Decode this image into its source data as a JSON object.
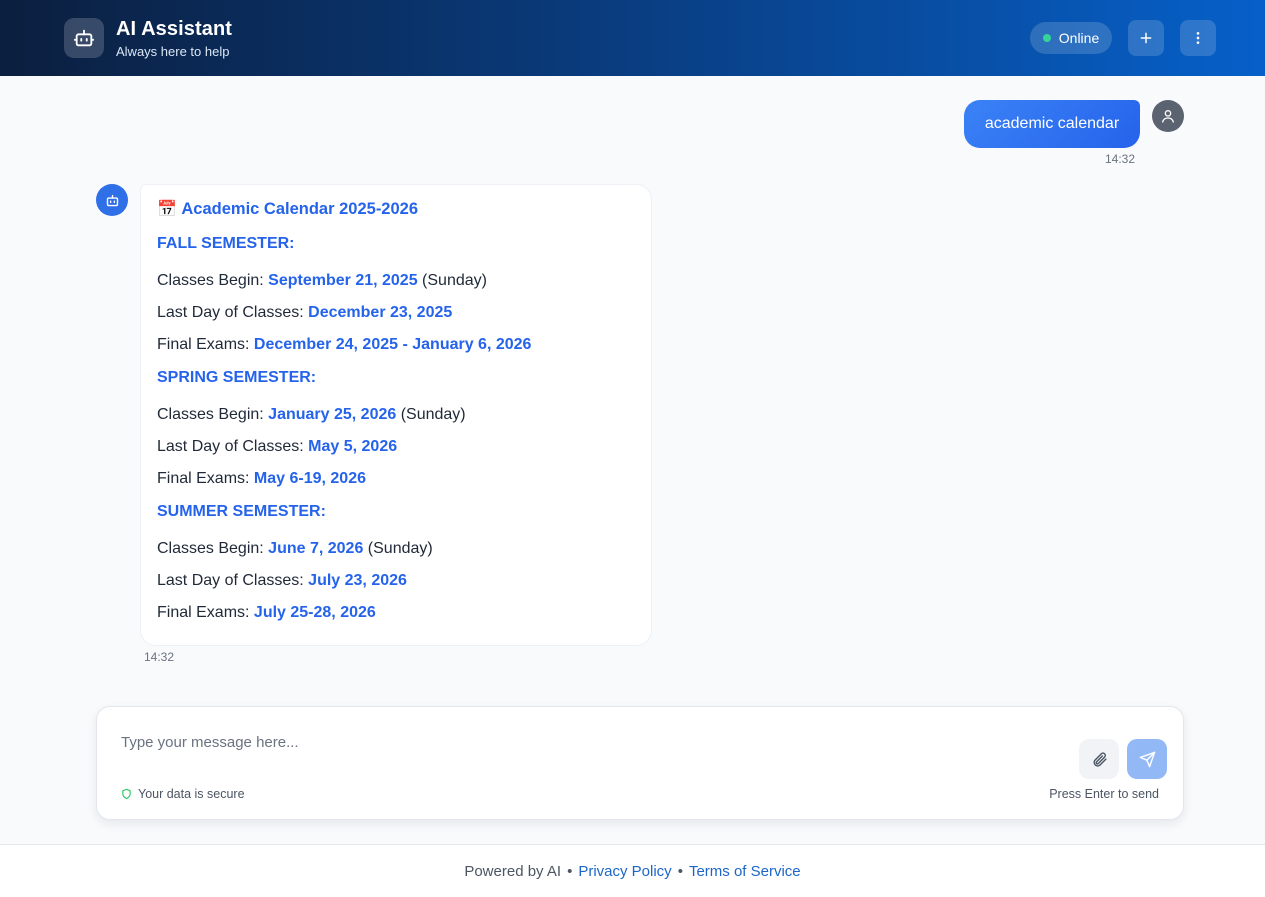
{
  "header": {
    "title": "AI Assistant",
    "subtitle": "Always here to help",
    "status": "Online",
    "accent_gradient": [
      "#0b1f3f",
      "#0660c9"
    ],
    "status_color": "#34d399"
  },
  "conversation": {
    "user_message": {
      "text": "academic calendar",
      "time": "14:32"
    },
    "bot_message": {
      "time": "14:32",
      "title_icon": "📅",
      "title": "Academic Calendar 2025-2026",
      "sections": [
        {
          "heading": "FALL SEMESTER:",
          "rows": [
            {
              "label": "Classes Begin: ",
              "value": "September 21, 2025",
              "suffix": " (Sunday)"
            },
            {
              "label": "Last Day of Classes: ",
              "value": "December 23, 2025",
              "suffix": ""
            },
            {
              "label": "Final Exams: ",
              "value": "December 24, 2025 - January 6, 2026",
              "suffix": ""
            }
          ]
        },
        {
          "heading": "SPRING SEMESTER:",
          "rows": [
            {
              "label": "Classes Begin: ",
              "value": "January 25, 2026",
              "suffix": " (Sunday)"
            },
            {
              "label": "Last Day of Classes: ",
              "value": "May 5, 2026",
              "suffix": ""
            },
            {
              "label": "Final Exams: ",
              "value": "May 6-19, 2026",
              "suffix": ""
            }
          ]
        },
        {
          "heading": "SUMMER SEMESTER:",
          "rows": [
            {
              "label": "Classes Begin: ",
              "value": "June 7, 2026",
              "suffix": " (Sunday)"
            },
            {
              "label": "Last Day of Classes: ",
              "value": "July 23, 2026",
              "suffix": ""
            },
            {
              "label": "Final Exams: ",
              "value": "July 25-28, 2026",
              "suffix": ""
            }
          ]
        }
      ]
    }
  },
  "composer": {
    "placeholder": "Type your message here...",
    "secure_text": "Your data is secure",
    "hint": "Press Enter to send"
  },
  "footer": {
    "powered": "Powered by AI",
    "sep": "•",
    "privacy": "Privacy Policy",
    "terms": "Terms of Service"
  }
}
